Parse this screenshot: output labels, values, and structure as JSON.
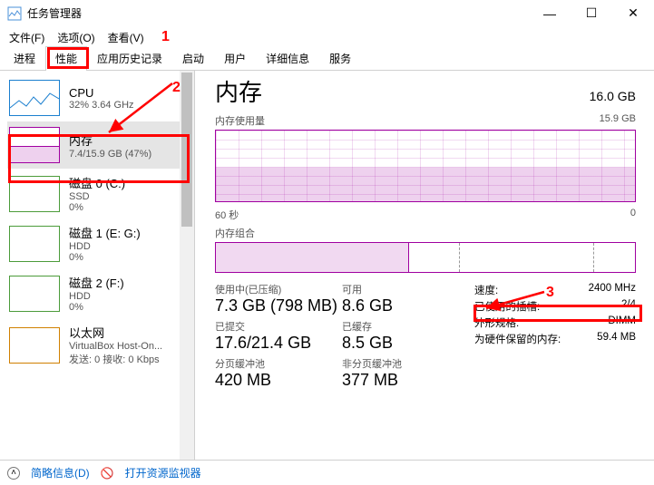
{
  "window": {
    "title": "任务管理器"
  },
  "menus": {
    "file": "文件(F)",
    "options": "选项(O)",
    "view": "查看(V)"
  },
  "tabs": [
    "进程",
    "性能",
    "应用历史记录",
    "启动",
    "用户",
    "详细信息",
    "服务"
  ],
  "active_tab_index": 1,
  "sidebar": [
    {
      "title": "CPU",
      "sub": "32% 3.64 GHz",
      "cls": "cpu"
    },
    {
      "title": "内存",
      "sub": "7.4/15.9 GB (47%)",
      "cls": "mem",
      "selected": true
    },
    {
      "title": "磁盘 0 (C:)",
      "sub": "SSD",
      "sub2": "0%",
      "cls": "disk"
    },
    {
      "title": "磁盘 1 (E: G:)",
      "sub": "HDD",
      "sub2": "0%",
      "cls": "disk"
    },
    {
      "title": "磁盘 2 (F:)",
      "sub": "HDD",
      "sub2": "0%",
      "cls": "disk"
    },
    {
      "title": "以太网",
      "sub": "VirtualBox Host-On...",
      "sub2": "发送: 0 接收: 0 Kbps",
      "cls": "eth"
    }
  ],
  "main": {
    "title": "内存",
    "total": "16.0 GB",
    "usage_label": "内存使用量",
    "usage_max": "15.9 GB",
    "xaxis_left": "60 秒",
    "xaxis_right": "0",
    "composition_label": "内存组合",
    "stats": {
      "in_use_label": "使用中(已压缩)",
      "in_use": "7.3 GB (798 MB)",
      "available_label": "可用",
      "available": "8.6 GB",
      "committed_label": "已提交",
      "committed": "17.6/21.4 GB",
      "cached_label": "已缓存",
      "cached": "8.5 GB",
      "paged_label": "分页缓冲池",
      "paged": "420 MB",
      "nonpaged_label": "非分页缓冲池",
      "nonpaged": "377 MB"
    },
    "details": {
      "speed_label": "速度:",
      "speed": "2400 MHz",
      "slots_label": "已使用的插槽:",
      "slots": "2/4",
      "form_label": "外形规格:",
      "form": "DIMM",
      "reserved_label": "为硬件保留的内存:",
      "reserved": "59.4 MB"
    }
  },
  "footer": {
    "brief": "简略信息(D)",
    "monitor": "打开资源监视器"
  },
  "annotations": {
    "n1": "1",
    "n2": "2",
    "n3": "3"
  },
  "chart_data": {
    "type": "area",
    "title": "内存使用量",
    "ylabel": "GB",
    "ylim": [
      0,
      15.9
    ],
    "x_range_seconds": [
      60,
      0
    ],
    "series": [
      {
        "name": "使用中",
        "approx_constant_value_gb": 7.4
      }
    ]
  }
}
